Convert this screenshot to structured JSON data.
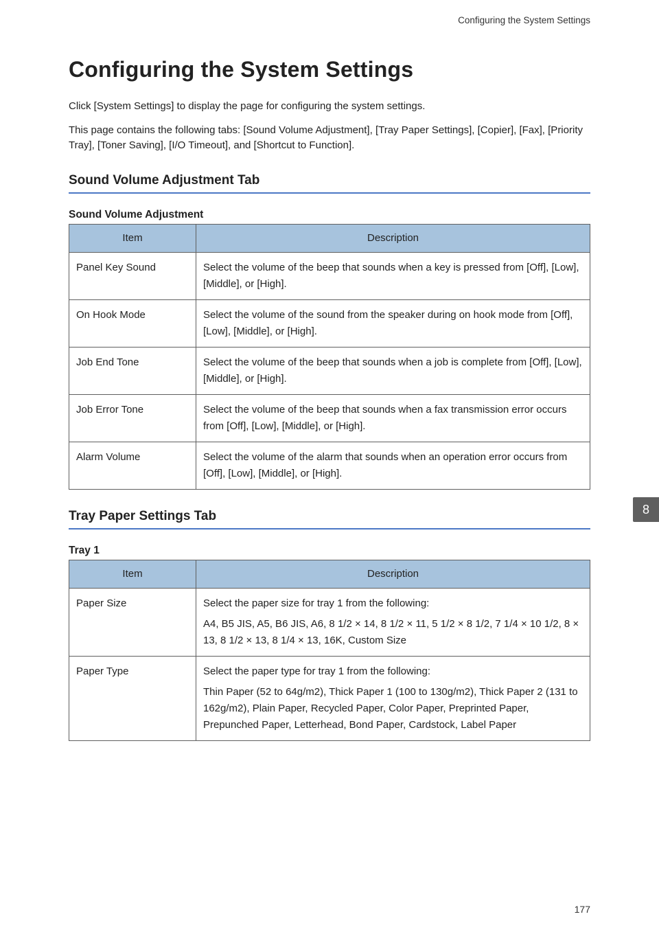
{
  "running_head": "Configuring the System Settings",
  "page_title": "Configuring the System Settings",
  "intro_paragraphs": [
    "Click [System Settings] to display the page for configuring the system settings.",
    "This page contains the following tabs: [Sound Volume Adjustment], [Tray Paper Settings], [Copier], [Fax], [Priority Tray], [Toner Saving], [I/O Timeout], and [Shortcut to Function]."
  ],
  "sections": [
    {
      "title": "Sound Volume Adjustment Tab",
      "tables": [
        {
          "caption": "Sound Volume Adjustment",
          "columns": [
            "Item",
            "Description"
          ],
          "rows": [
            {
              "item": "Panel Key Sound",
              "desc": [
                "Select the volume of the beep that sounds when a key is pressed from [Off], [Low], [Middle], or [High]."
              ]
            },
            {
              "item": "On Hook Mode",
              "desc": [
                "Select the volume of the sound from the speaker during on hook mode from [Off], [Low], [Middle], or [High]."
              ]
            },
            {
              "item": "Job End Tone",
              "desc": [
                "Select the volume of the beep that sounds when a job is complete from [Off], [Low], [Middle], or [High]."
              ]
            },
            {
              "item": "Job Error Tone",
              "desc": [
                "Select the volume of the beep that sounds when a fax transmission error occurs from [Off], [Low], [Middle], or [High]."
              ]
            },
            {
              "item": "Alarm Volume",
              "desc": [
                "Select the volume of the alarm that sounds when an operation error occurs from [Off], [Low], [Middle], or [High]."
              ]
            }
          ]
        }
      ]
    },
    {
      "title": "Tray Paper Settings Tab",
      "tables": [
        {
          "caption": "Tray 1",
          "columns": [
            "Item",
            "Description"
          ],
          "rows": [
            {
              "item": "Paper Size",
              "desc": [
                "Select the paper size for tray 1 from the following:",
                "A4, B5 JIS, A5, B6 JIS, A6, 8 1/2 × 14, 8 1/2 × 11, 5 1/2 × 8 1/2, 7 1/4 × 10 1/2, 8 × 13, 8 1/2 × 13, 8 1/4 × 13, 16K, Custom Size"
              ]
            },
            {
              "item": "Paper Type",
              "desc": [
                "Select the paper type for tray 1 from the following:",
                "Thin Paper (52 to 64g/m2), Thick Paper 1 (100 to 130g/m2), Thick Paper 2 (131 to 162g/m2), Plain Paper, Recycled Paper, Color Paper, Preprinted Paper, Prepunched Paper, Letterhead, Bond Paper, Cardstock, Label Paper"
              ]
            }
          ]
        }
      ]
    }
  ],
  "side_tab": "8",
  "page_number": "177"
}
